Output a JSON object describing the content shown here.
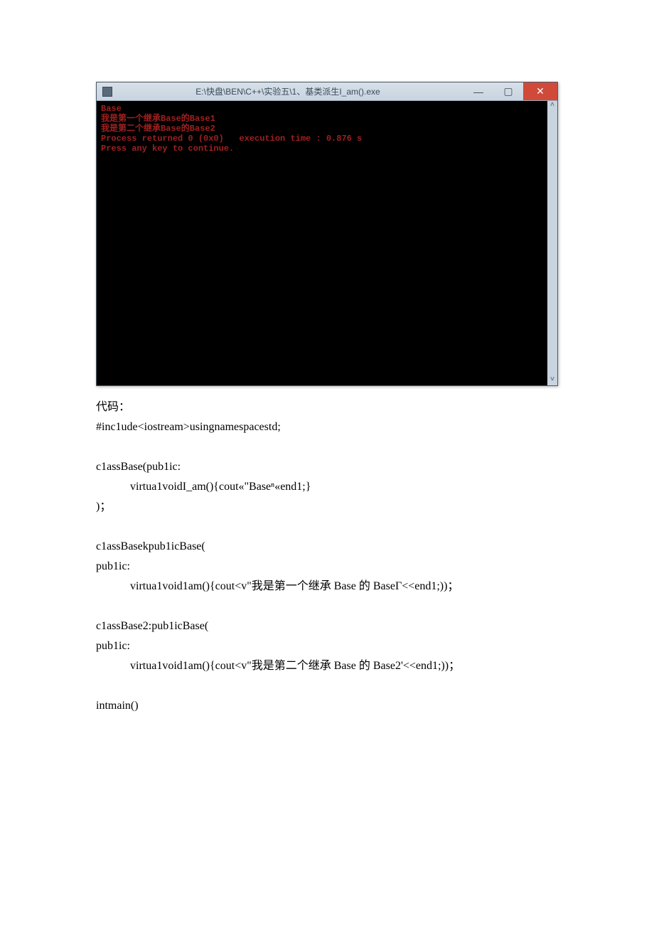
{
  "window": {
    "title": "E:\\快盘\\BEN\\C++\\实验五\\1、基类派生I_am().exe",
    "minimize": "—",
    "maximize": "▢",
    "close": "✕",
    "scroll_up": "˄",
    "scroll_down": "˅"
  },
  "console": {
    "line1": "Base",
    "line2": "我是第一个继承Base的Base1",
    "line3": "我是第二个继承Base的Base2",
    "line4": "",
    "line5": "Process returned 0 (0x0)   execution time : 0.876 s",
    "line6": "Press any key to continue."
  },
  "code": {
    "label": "代码：",
    "l1": "#inc1ude<iostream>usingnamespacestd;",
    "l2": "c1assBase(pub1ic:",
    "l3": "virtua1voidI_am(){cout«\"Baseⁿ«end1;}",
    "l4": ")；",
    "l5": "c1assBasekpub1icBase(",
    "l6": "pub1ic:",
    "l7": "virtua1void1am(){cout<v\"我是第一个继承 Base 的 BaseΓ<<end1;))；",
    "l8": "c1assBase2:pub1icBase(",
    "l9": "pub1ic:",
    "l10": "virtua1void1am(){cout<v\"我是第二个继承 Base 的 Base2'<<end1;))；",
    "l11": "intmain()"
  }
}
